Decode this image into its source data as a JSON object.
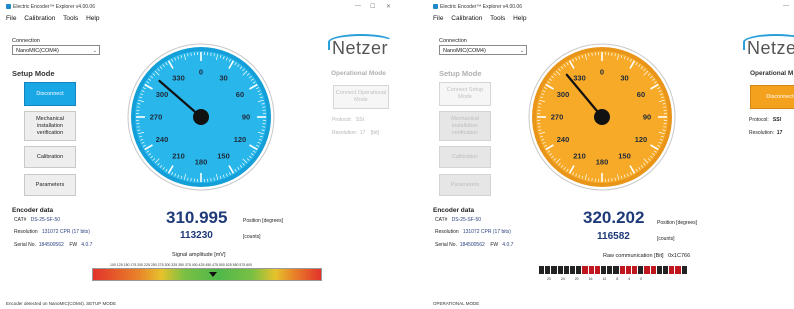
{
  "app": {
    "title": "Electric Encoder™ Explorer v4.00.06",
    "menu": [
      "File",
      "Calibration",
      "Tools",
      "Help"
    ],
    "logo_text": "Netzer"
  },
  "left": {
    "connection_label": "Connection",
    "connection_value": "NanoMIC(COM4)",
    "setup_mode_title": "Setup Mode",
    "buttons": {
      "disconnect": "Disconnect",
      "mechanical": "Mechanical installation verification",
      "calibration": "Calibration",
      "parameters": "Parameters"
    },
    "operational_mode_title": "Operational Mode",
    "connect_operational": "Connect Operational Mode",
    "protocol_label": "Protocol:",
    "protocol_value": "SSI",
    "resolution_label": "Resolution:",
    "resolution_value": "17",
    "resolution_unit": "[bit]",
    "encoder_data_title": "Encoder data",
    "cat_label": "CAT#",
    "cat_value": "DS-25-SF-50",
    "res_label": "Resolution",
    "res_value": "131072 CPR (17 bits)",
    "serial_label": "Serial No.",
    "serial_value": "184500562",
    "fw_label": "FW",
    "fw_value": "4.0.7",
    "position_value": "310.995",
    "position_unit": "Position [degrees]",
    "counts_value": "113230",
    "counts_unit": "[counts]",
    "signal_label": "Signal amplitude [mV]",
    "signal_ticks": "100 125 150 175 200 225 250 275 300 325 350 375 400 425 450 475 500 525 550 575 600",
    "status_text": "Encoder detected on NanoMIC(COM4). SETUP MODE",
    "gauge_angle": 310.995
  },
  "right": {
    "connection_label": "Connection",
    "connection_value": "NanoMIC(COM4)",
    "setup_mode_title": "Setup Mode",
    "buttons": {
      "connect_setup": "Connect Setup Mode",
      "mechanical": "Mechanical installation verification",
      "calibration": "Calibration",
      "parameters": "Parameters"
    },
    "operational_mode_title": "Operational M",
    "disconnect": "Disconnect",
    "protocol_label": "Protocol:",
    "protocol_value": "SSI",
    "resolution_label": "Resolution:",
    "resolution_value": "17",
    "encoder_data_title": "Encoder data",
    "cat_label": "CAT#",
    "cat_value": "DS-25-SF-50",
    "res_label": "Resolution",
    "res_value": "131072 CPR (17 bits)",
    "serial_label": "Serial No.",
    "serial_value": "184500562",
    "fw_label": "FW",
    "fw_value": "4.0.7",
    "position_value": "320.202",
    "position_unit": "Position [degrees]",
    "counts_value": "116582",
    "counts_unit": "[counts]",
    "raw_label": "Raw communication [Bit]",
    "raw_value": "0x1C766",
    "raw_ticks": "20 24 20 16 12 8 4 0",
    "status_text": "OPERATIONAL MODE",
    "gauge_angle": 320.202
  },
  "gauge_labels": [
    "0",
    "30",
    "60",
    "90",
    "120",
    "150",
    "180",
    "210",
    "240",
    "270",
    "300",
    "330"
  ],
  "colors": {
    "setup_accent": "#1aa7e6",
    "operational_accent": "#f4a11d",
    "value_text": "#1f3a78"
  }
}
